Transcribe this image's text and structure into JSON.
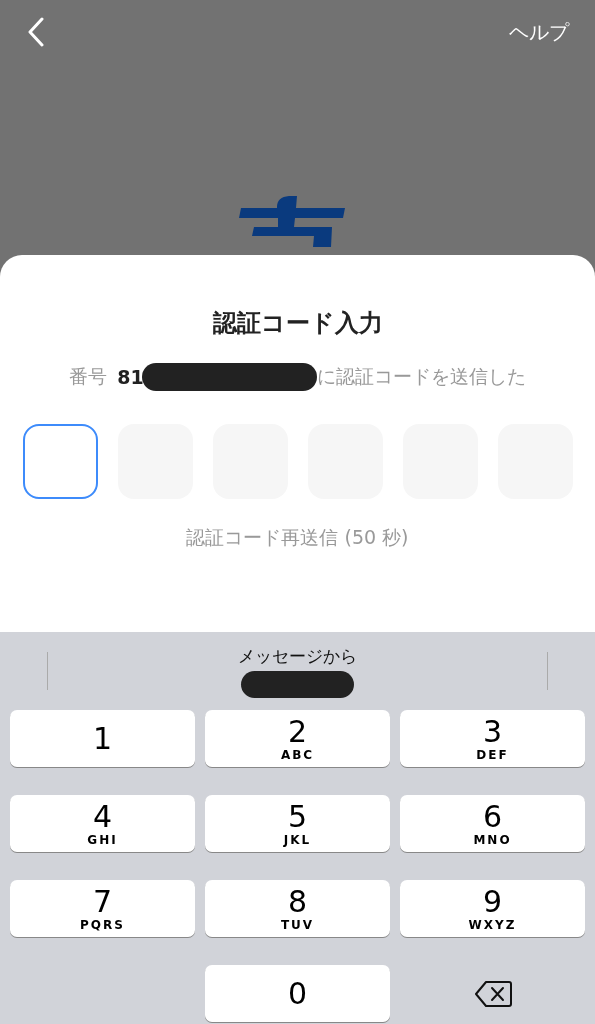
{
  "header": {
    "help": "ヘルプ"
  },
  "sheet": {
    "title": "認証コード入力",
    "number_label": "番号",
    "number_prefix": "81",
    "sent_text": "に認証コードを送信した",
    "code_boxes": [
      {
        "selected": true
      },
      {
        "selected": false
      },
      {
        "selected": false
      },
      {
        "selected": false
      },
      {
        "selected": false
      },
      {
        "selected": false
      }
    ],
    "resend": "認証コード再送信 (50 秒)"
  },
  "keyboard": {
    "suggestion": "メッセージから",
    "keys": [
      {
        "kind": "digit",
        "digit": "1"
      },
      {
        "kind": "digit",
        "digit": "2",
        "letters": "ABC"
      },
      {
        "kind": "digit",
        "digit": "3",
        "letters": "DEF"
      },
      {
        "kind": "digit",
        "digit": "4",
        "letters": "GHI"
      },
      {
        "kind": "digit",
        "digit": "5",
        "letters": "JKL"
      },
      {
        "kind": "digit",
        "digit": "6",
        "letters": "MNO"
      },
      {
        "kind": "digit",
        "digit": "7",
        "letters": "PQRS"
      },
      {
        "kind": "digit",
        "digit": "8",
        "letters": "TUV"
      },
      {
        "kind": "digit",
        "digit": "9",
        "letters": "WXYZ"
      },
      {
        "kind": "digit",
        "digit": "0"
      },
      {
        "kind": "delete"
      }
    ]
  }
}
